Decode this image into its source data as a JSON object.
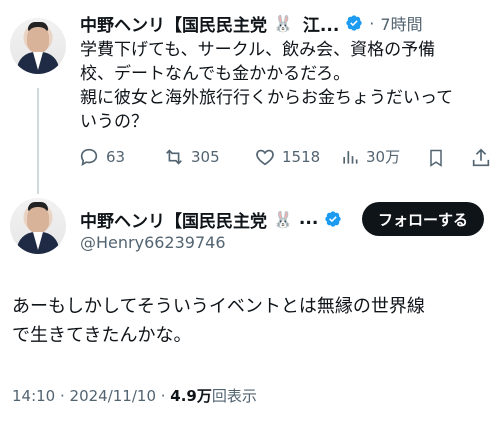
{
  "reply_tweet": {
    "author_name": "中野ヘンリ【国民民主党",
    "author_suffix": "江...",
    "time": "7時間",
    "text_lines": [
      "学費下げても、サークル、飲み会、資格の予備",
      "校、デートなんでも金かかるだろ。",
      "親に彼女と海外旅行行くからお金ちょうだいって",
      "いうの？"
    ],
    "actions": {
      "replies": "63",
      "reposts": "305",
      "likes": "1518",
      "views": "30万"
    }
  },
  "main_tweet": {
    "author_name": "中野ヘンリ【国民民主党",
    "author_suffix": "...",
    "handle": "@Henry66239746",
    "follow_label": "フォローする",
    "text_lines": [
      "あーもしかしてそういうイベントとは無縁の世界線",
      "で生きてきたんかな。"
    ],
    "meta_time": "14:10 · 2024/11/10 · ",
    "meta_views_count": "4.9万",
    "meta_views_label": "回表示"
  },
  "icons": [
    "reply-icon",
    "repost-icon",
    "like-icon",
    "views-icon",
    "bookmark-icon",
    "share-icon",
    "verified-badge-icon",
    "bunny-emoji"
  ],
  "colors": {
    "verified": "#1d9bf0",
    "text": "#0f1419",
    "muted": "#536471",
    "line": "#cfd9de"
  }
}
